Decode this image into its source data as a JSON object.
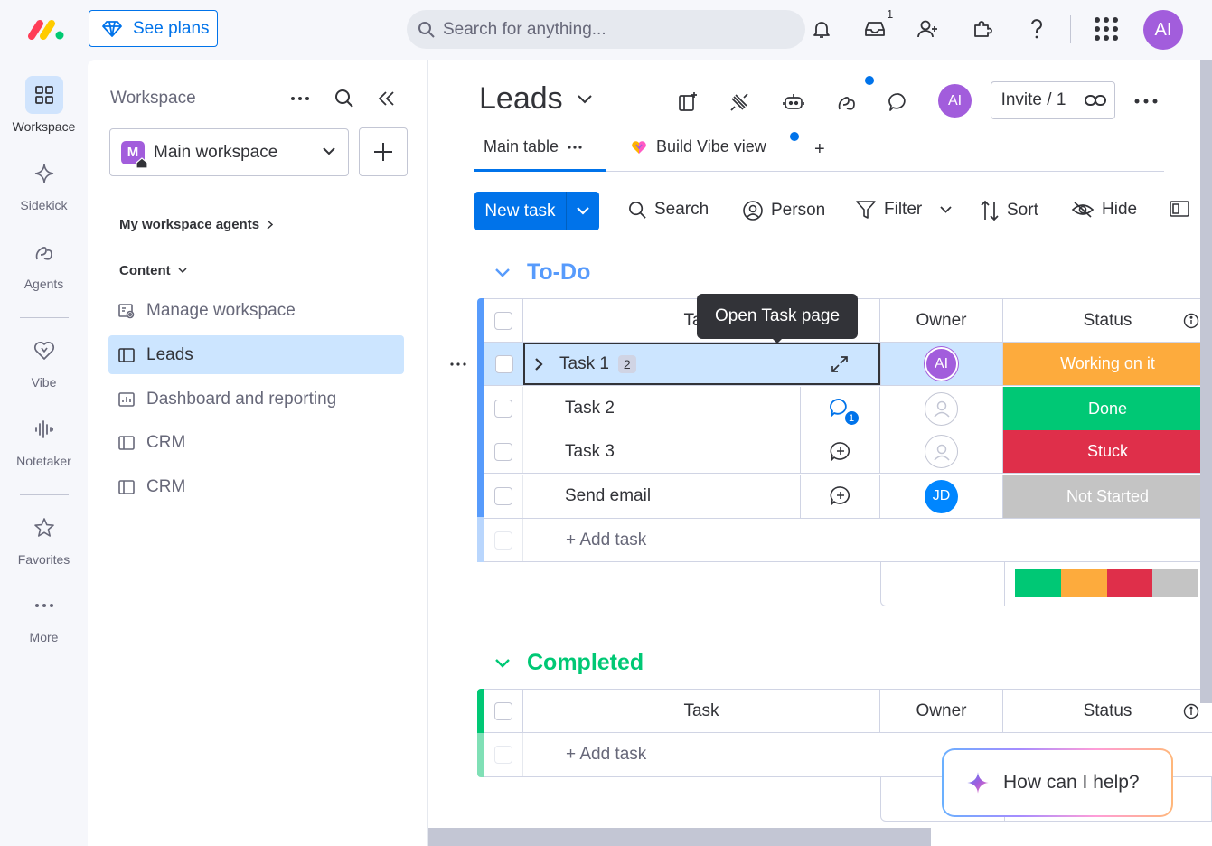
{
  "topbar": {
    "see_plans": "See plans",
    "search_placeholder": "Search for anything...",
    "inbox_count": "1",
    "avatar": "AI",
    "icons": [
      "bell-icon",
      "inbox-icon",
      "invite-user-icon",
      "puzzle-icon",
      "help-icon",
      "apps-grid-icon"
    ]
  },
  "rail": {
    "items": [
      {
        "label": "Workspace",
        "icon": "grid-icon"
      },
      {
        "label": "Sidekick",
        "icon": "sparkle-icon"
      },
      {
        "label": "Agents",
        "icon": "agents-icon"
      },
      {
        "label": "Vibe",
        "icon": "heart-icon"
      },
      {
        "label": "Notetaker",
        "icon": "waveform-icon"
      },
      {
        "label": "Favorites",
        "icon": "star-icon"
      },
      {
        "label": "More",
        "icon": "more-icon"
      }
    ]
  },
  "workspace": {
    "title": "Workspace",
    "selected": "Main workspace",
    "badge": "M",
    "agents_section": "My workspace agents",
    "content_section": "Content",
    "items": [
      {
        "label": "Manage workspace",
        "icon": "manage-icon"
      },
      {
        "label": "Leads",
        "icon": "board-icon"
      },
      {
        "label": "Dashboard and reporting",
        "icon": "dashboard-icon"
      },
      {
        "label": "CRM",
        "icon": "board-icon"
      },
      {
        "label": "CRM",
        "icon": "board-icon"
      }
    ]
  },
  "board": {
    "title": "Leads",
    "avatar": "AI",
    "invite": "Invite / 1",
    "tabs": {
      "main": "Main table",
      "vibe": "Build Vibe view",
      "add": "+"
    },
    "toolbar": {
      "new_task": "New task",
      "search": "Search",
      "person": "Person",
      "filter": "Filter",
      "sort": "Sort",
      "hide": "Hide"
    },
    "tooltip": "Open Task page"
  },
  "todo": {
    "title": "To-Do",
    "color": "#579bfc",
    "columns": {
      "task": "Task",
      "owner": "Owner",
      "status": "Status"
    },
    "rows": [
      {
        "task": "Task 1",
        "subitems": "2",
        "owner": "AI",
        "owner_color": "#a25ddc",
        "status": "Working on it",
        "status_color": "#fdab3d"
      },
      {
        "task": "Task 2",
        "updates": "1",
        "owner": "",
        "status": "Done",
        "status_color": "#00c875"
      },
      {
        "task": "Task 3",
        "owner": "",
        "status": "Stuck",
        "status_color": "#df2f4a"
      },
      {
        "task": "Send email",
        "owner": "JD",
        "owner_color": "#0086ff",
        "status": "Not Started",
        "status_color": "#c4c4c4"
      }
    ],
    "add_task": "+ Add task",
    "summary": [
      {
        "color": "#00c875",
        "share": 0.25
      },
      {
        "color": "#fdab3d",
        "share": 0.25
      },
      {
        "color": "#df2f4a",
        "share": 0.25
      },
      {
        "color": "#c4c4c4",
        "share": 0.25
      }
    ]
  },
  "completed": {
    "title": "Completed",
    "color": "#00c875",
    "columns": {
      "task": "Task",
      "owner": "Owner",
      "status": "Status"
    },
    "add_task": "+ Add task"
  },
  "help": {
    "label": "How can I help?"
  }
}
